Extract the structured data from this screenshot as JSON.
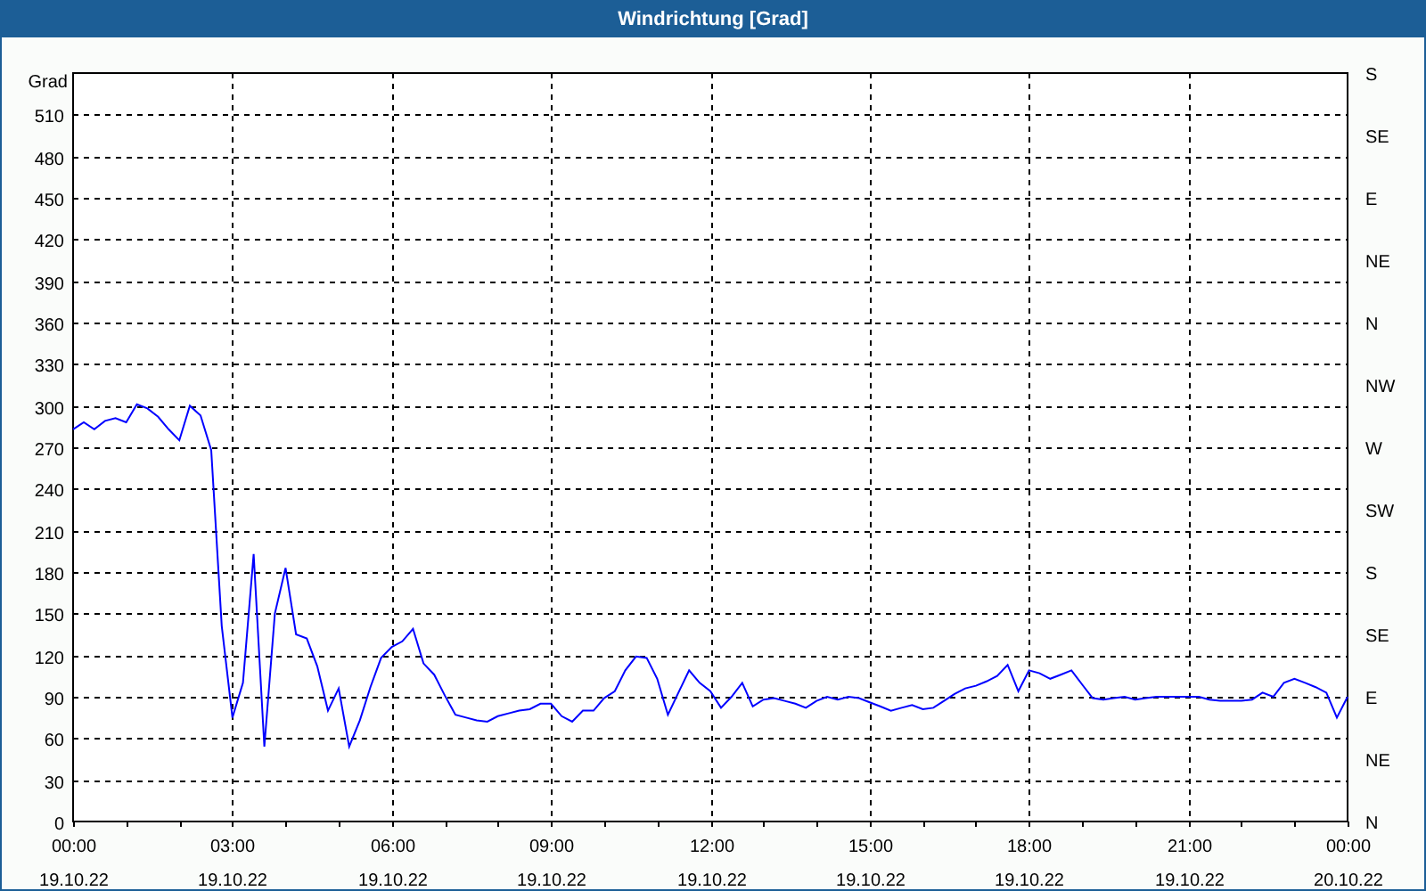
{
  "window": {
    "title": "Windrichtung [Grad]"
  },
  "chart": {
    "compass_labels": [
      "S",
      "SE",
      "E",
      "NE",
      "N",
      "NW",
      "W",
      "SW",
      "S",
      "SE",
      "E",
      "NE",
      "N"
    ],
    "chart_data": {
      "type": "line",
      "grid": true,
      "ylabel": "Grad",
      "ylim": [
        0,
        540
      ],
      "yticks": [
        0,
        30,
        60,
        90,
        120,
        150,
        180,
        210,
        240,
        270,
        300,
        330,
        360,
        390,
        420,
        450,
        480,
        510
      ],
      "categories": [
        "00:00 19.10.22",
        null,
        null,
        null,
        null,
        null,
        null,
        null,
        null,
        null,
        null,
        null,
        null,
        null,
        null,
        "03:00 19.10.22",
        null,
        null,
        null,
        null,
        null,
        null,
        null,
        null,
        null,
        null,
        null,
        null,
        null,
        null,
        "06:00 19.10.22",
        null,
        null,
        null,
        null,
        null,
        null,
        null,
        null,
        null,
        null,
        null,
        null,
        null,
        null,
        "09:00 19.10.22",
        null,
        null,
        null,
        null,
        null,
        null,
        null,
        null,
        null,
        null,
        null,
        null,
        null,
        null,
        "12:00 19.10.22",
        null,
        null,
        null,
        null,
        null,
        null,
        null,
        null,
        null,
        null,
        null,
        null,
        null,
        null,
        "15:00 19.10.22",
        null,
        null,
        null,
        null,
        null,
        null,
        null,
        null,
        null,
        null,
        null,
        null,
        null,
        null,
        "18:00 19.10.22",
        null,
        null,
        null,
        null,
        null,
        null,
        null,
        null,
        null,
        null,
        null,
        null,
        null,
        null,
        "21:00 19.10.22",
        null,
        null,
        null,
        null,
        null,
        null,
        null,
        null,
        null,
        null,
        null,
        null,
        null,
        null,
        "00:00 20.10.22"
      ],
      "series": [
        {
          "color": "#0000ff",
          "values": [
            283,
            288,
            283,
            289,
            291,
            288,
            301,
            298,
            292,
            283,
            275,
            300,
            293,
            268,
            141,
            75,
            100,
            193,
            54,
            150,
            183,
            135,
            132,
            112,
            80,
            96,
            54,
            73,
            97,
            118,
            126,
            130,
            139,
            114,
            106,
            91,
            77,
            75,
            73,
            72,
            76,
            78,
            80,
            81,
            85,
            85,
            76,
            72,
            80,
            80,
            89,
            94,
            109,
            119,
            118,
            103,
            77,
            93,
            109,
            100,
            94,
            82,
            90,
            100,
            83,
            88,
            89,
            87,
            85,
            82,
            87,
            90,
            88,
            90,
            89,
            86,
            83,
            80,
            82,
            84,
            81,
            82,
            87,
            92,
            96,
            98,
            101,
            105,
            113,
            94,
            109,
            107,
            103,
            106,
            109,
            99,
            89,
            88,
            89,
            90,
            88,
            89,
            90,
            90,
            90,
            90,
            90,
            88,
            87,
            87,
            87,
            88,
            93,
            90,
            100,
            103,
            100,
            97,
            93,
            75,
            90
          ]
        }
      ]
    }
  }
}
